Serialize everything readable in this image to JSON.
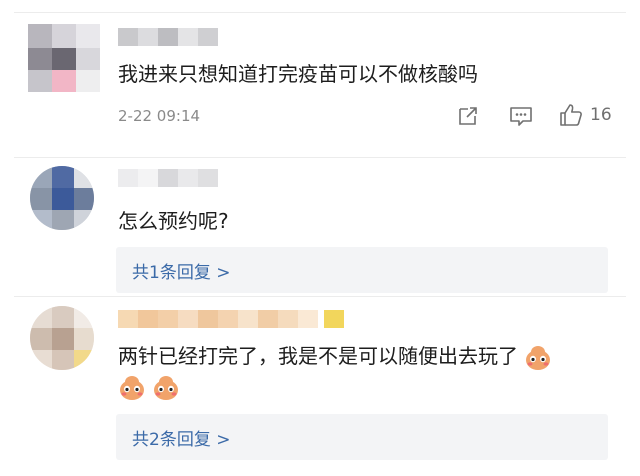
{
  "comments": [
    {
      "text": "我进来只想知道打完疫苗可以不做核酸吗",
      "timestamp": "2-22 09:14",
      "like_count": "16",
      "actions": [
        "share-icon",
        "comment-icon",
        "thumbs-up-icon"
      ]
    },
    {
      "text": "怎么预约呢?",
      "reply_summary": "共1条回复 >"
    },
    {
      "text": "两针已经打完了，我是不是可以随便出去玩了",
      "emoji_name": "blushing-face-emoji",
      "reply_summary": "共2条回复 >"
    }
  ],
  "colors": {
    "reply_link": "#3b6aa8",
    "reply_bg": "#f3f4f6",
    "meta_text": "#8a8a8a"
  }
}
